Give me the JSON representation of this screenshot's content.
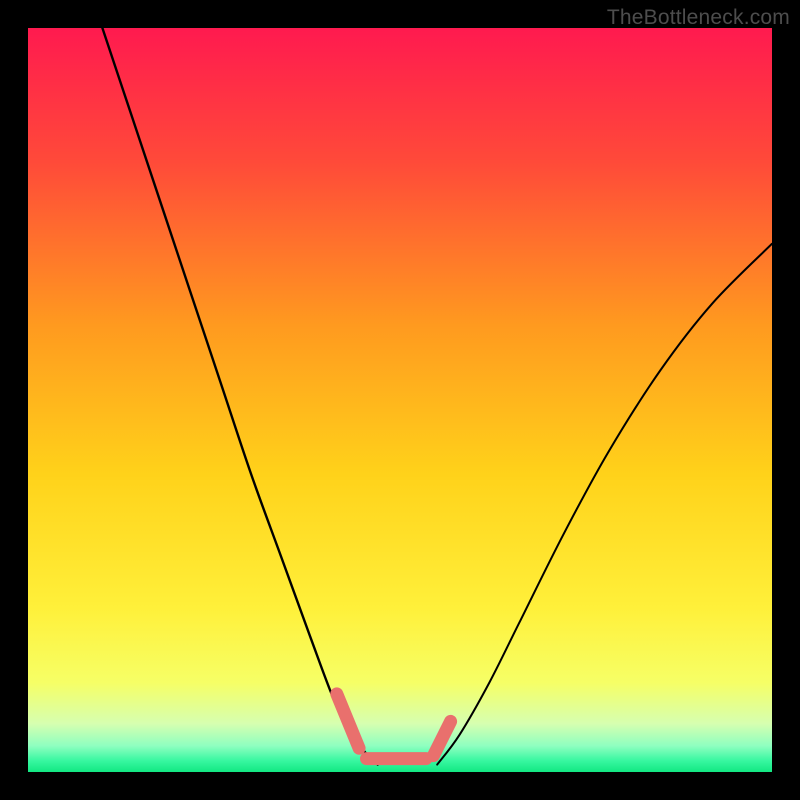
{
  "watermark": "TheBottleneck.com",
  "chart_data": {
    "type": "line",
    "title": "",
    "xlabel": "",
    "ylabel": "",
    "xlim": [
      0,
      100
    ],
    "ylim": [
      0,
      100
    ],
    "series": [
      {
        "name": "left-curve",
        "x": [
          10,
          14,
          18,
          22,
          26,
          30,
          34,
          38,
          41,
          43,
          45,
          47
        ],
        "y": [
          100,
          88,
          76,
          64,
          52,
          40,
          29,
          18,
          10,
          6,
          3,
          1
        ]
      },
      {
        "name": "right-curve",
        "x": [
          55,
          58,
          62,
          66,
          72,
          78,
          85,
          92,
          100
        ],
        "y": [
          1,
          5,
          12,
          20,
          32,
          43,
          54,
          63,
          71
        ]
      }
    ],
    "highlight_segments": [
      {
        "name": "left-dash",
        "points": [
          [
            41.5,
            10.5
          ],
          [
            44.5,
            3.2
          ]
        ]
      },
      {
        "name": "bottom-dash",
        "points": [
          [
            45.5,
            1.8
          ],
          [
            53.5,
            1.8
          ]
        ]
      },
      {
        "name": "right-dash",
        "points": [
          [
            54.5,
            2.2
          ],
          [
            56.8,
            6.8
          ]
        ]
      }
    ],
    "gradient_stops": [
      {
        "offset": 0.0,
        "color": "#ff1a4f"
      },
      {
        "offset": 0.18,
        "color": "#ff4a39"
      },
      {
        "offset": 0.4,
        "color": "#ff9a1f"
      },
      {
        "offset": 0.6,
        "color": "#ffd21a"
      },
      {
        "offset": 0.78,
        "color": "#fff03a"
      },
      {
        "offset": 0.88,
        "color": "#f6ff66"
      },
      {
        "offset": 0.935,
        "color": "#d6ffb0"
      },
      {
        "offset": 0.965,
        "color": "#8effc0"
      },
      {
        "offset": 0.985,
        "color": "#37f7a0"
      },
      {
        "offset": 1.0,
        "color": "#12e882"
      }
    ],
    "curve_color": "#000000",
    "highlight_color": "#e9706d"
  }
}
